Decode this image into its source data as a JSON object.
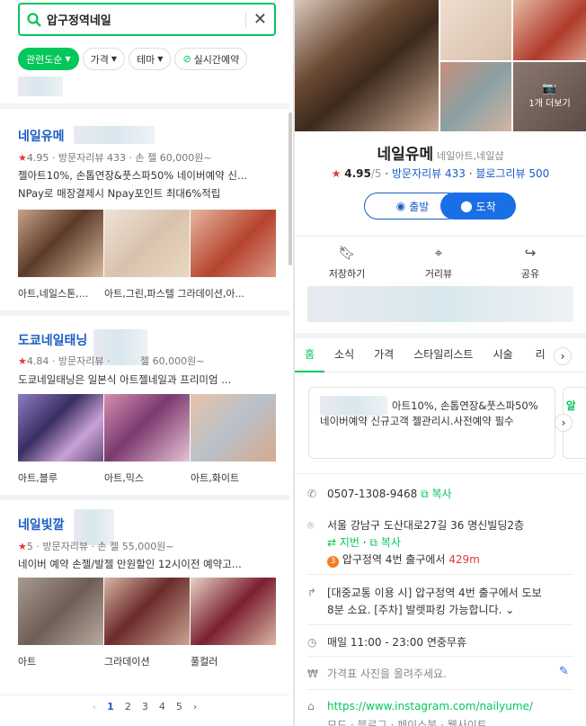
{
  "search": {
    "query": "압구정역네일",
    "clear": "✕"
  },
  "chips": [
    "관련도순",
    "가격",
    "테마",
    "실시간예약"
  ],
  "results": [
    {
      "name": "네일유메",
      "rating": "4.95",
      "visitor_reviews": "방문자리뷰 433",
      "price": "손 젤 60,000원~",
      "desc1": "젤아트10%, 손톱연장&풋스파50% 네이버예약 신...",
      "desc2": "NPay로 매장결제시 Npay포인트 최대6%적립",
      "captions": [
        "아트,네일스톤,...",
        "아트,그린,파스텔 그라데이션,아...",
        ""
      ]
    },
    {
      "name": "도쿄네일태닝",
      "rating": "4.84",
      "visitor_reviews": "방문자리뷰",
      "price": "젤 60,000원~",
      "desc1": "도쿄네일태닝은 일본식 아트젤네일과 프리미엄 ...",
      "captions": [
        "아트,블루",
        "아트,믹스",
        "아트,화이트"
      ]
    },
    {
      "name": "네일빛깔",
      "rating": "5",
      "visitor_reviews": "방문자리뷰",
      "price": "손 젤 55,000원~",
      "desc1": "네이버 예약 손젤/발젤 만원할인 12시이전 예약고...",
      "captions": [
        "아트",
        "그라데이션",
        "풀컬러"
      ]
    }
  ],
  "pager": {
    "prev": "‹",
    "pages": [
      "1",
      "2",
      "3",
      "4",
      "5"
    ],
    "next": "›"
  },
  "place": {
    "more_photos": "1개 더보기",
    "name": "네일유메",
    "category": "네일아트,네일샵",
    "rating": "4.95",
    "rating_max": "/5",
    "visitor_reviews": "방문자리뷰 433",
    "blog_reviews": "블로그리뷰 500",
    "depart": "출발",
    "arrive": "도착",
    "actions": [
      "저장하기",
      "거리뷰",
      "공유"
    ],
    "tabs": [
      "홈",
      "소식",
      "가격",
      "스타일리스트",
      "시술",
      "리"
    ],
    "notice1": "아트10%, 손톱연장&풋스파50%",
    "notice2": "네이버예약 신규고객 젤관리시.사전예약 필수",
    "notice_next": "알",
    "phone": "0507-1308-9468",
    "copy": "복사",
    "address": "서울 강남구 도산대로27길 36 명신빌딩2층",
    "jibun": "지번",
    "subway_num": "3",
    "subway": "압구정역 4번 출구에서",
    "distance": "429m",
    "directions1": "[대중교통 이용 시] 압구정역 4번 출구에서 도보",
    "directions2": "8분 소요. [주차] 발렛파킹 가능합니다.",
    "hours": "매일 11:00 - 23:00 연중무휴",
    "price_prompt": "가격표 사진을 올려주세요.",
    "url": "https://www.instagram.com/nailyume/",
    "links": "모드 · 블로그 · 페이스북 · 웹사이트"
  },
  "colors": {
    "accent": "#03c75a",
    "link": "#1a5dc4",
    "star": "#e03a3e",
    "price_distance": "#e03a3e"
  }
}
